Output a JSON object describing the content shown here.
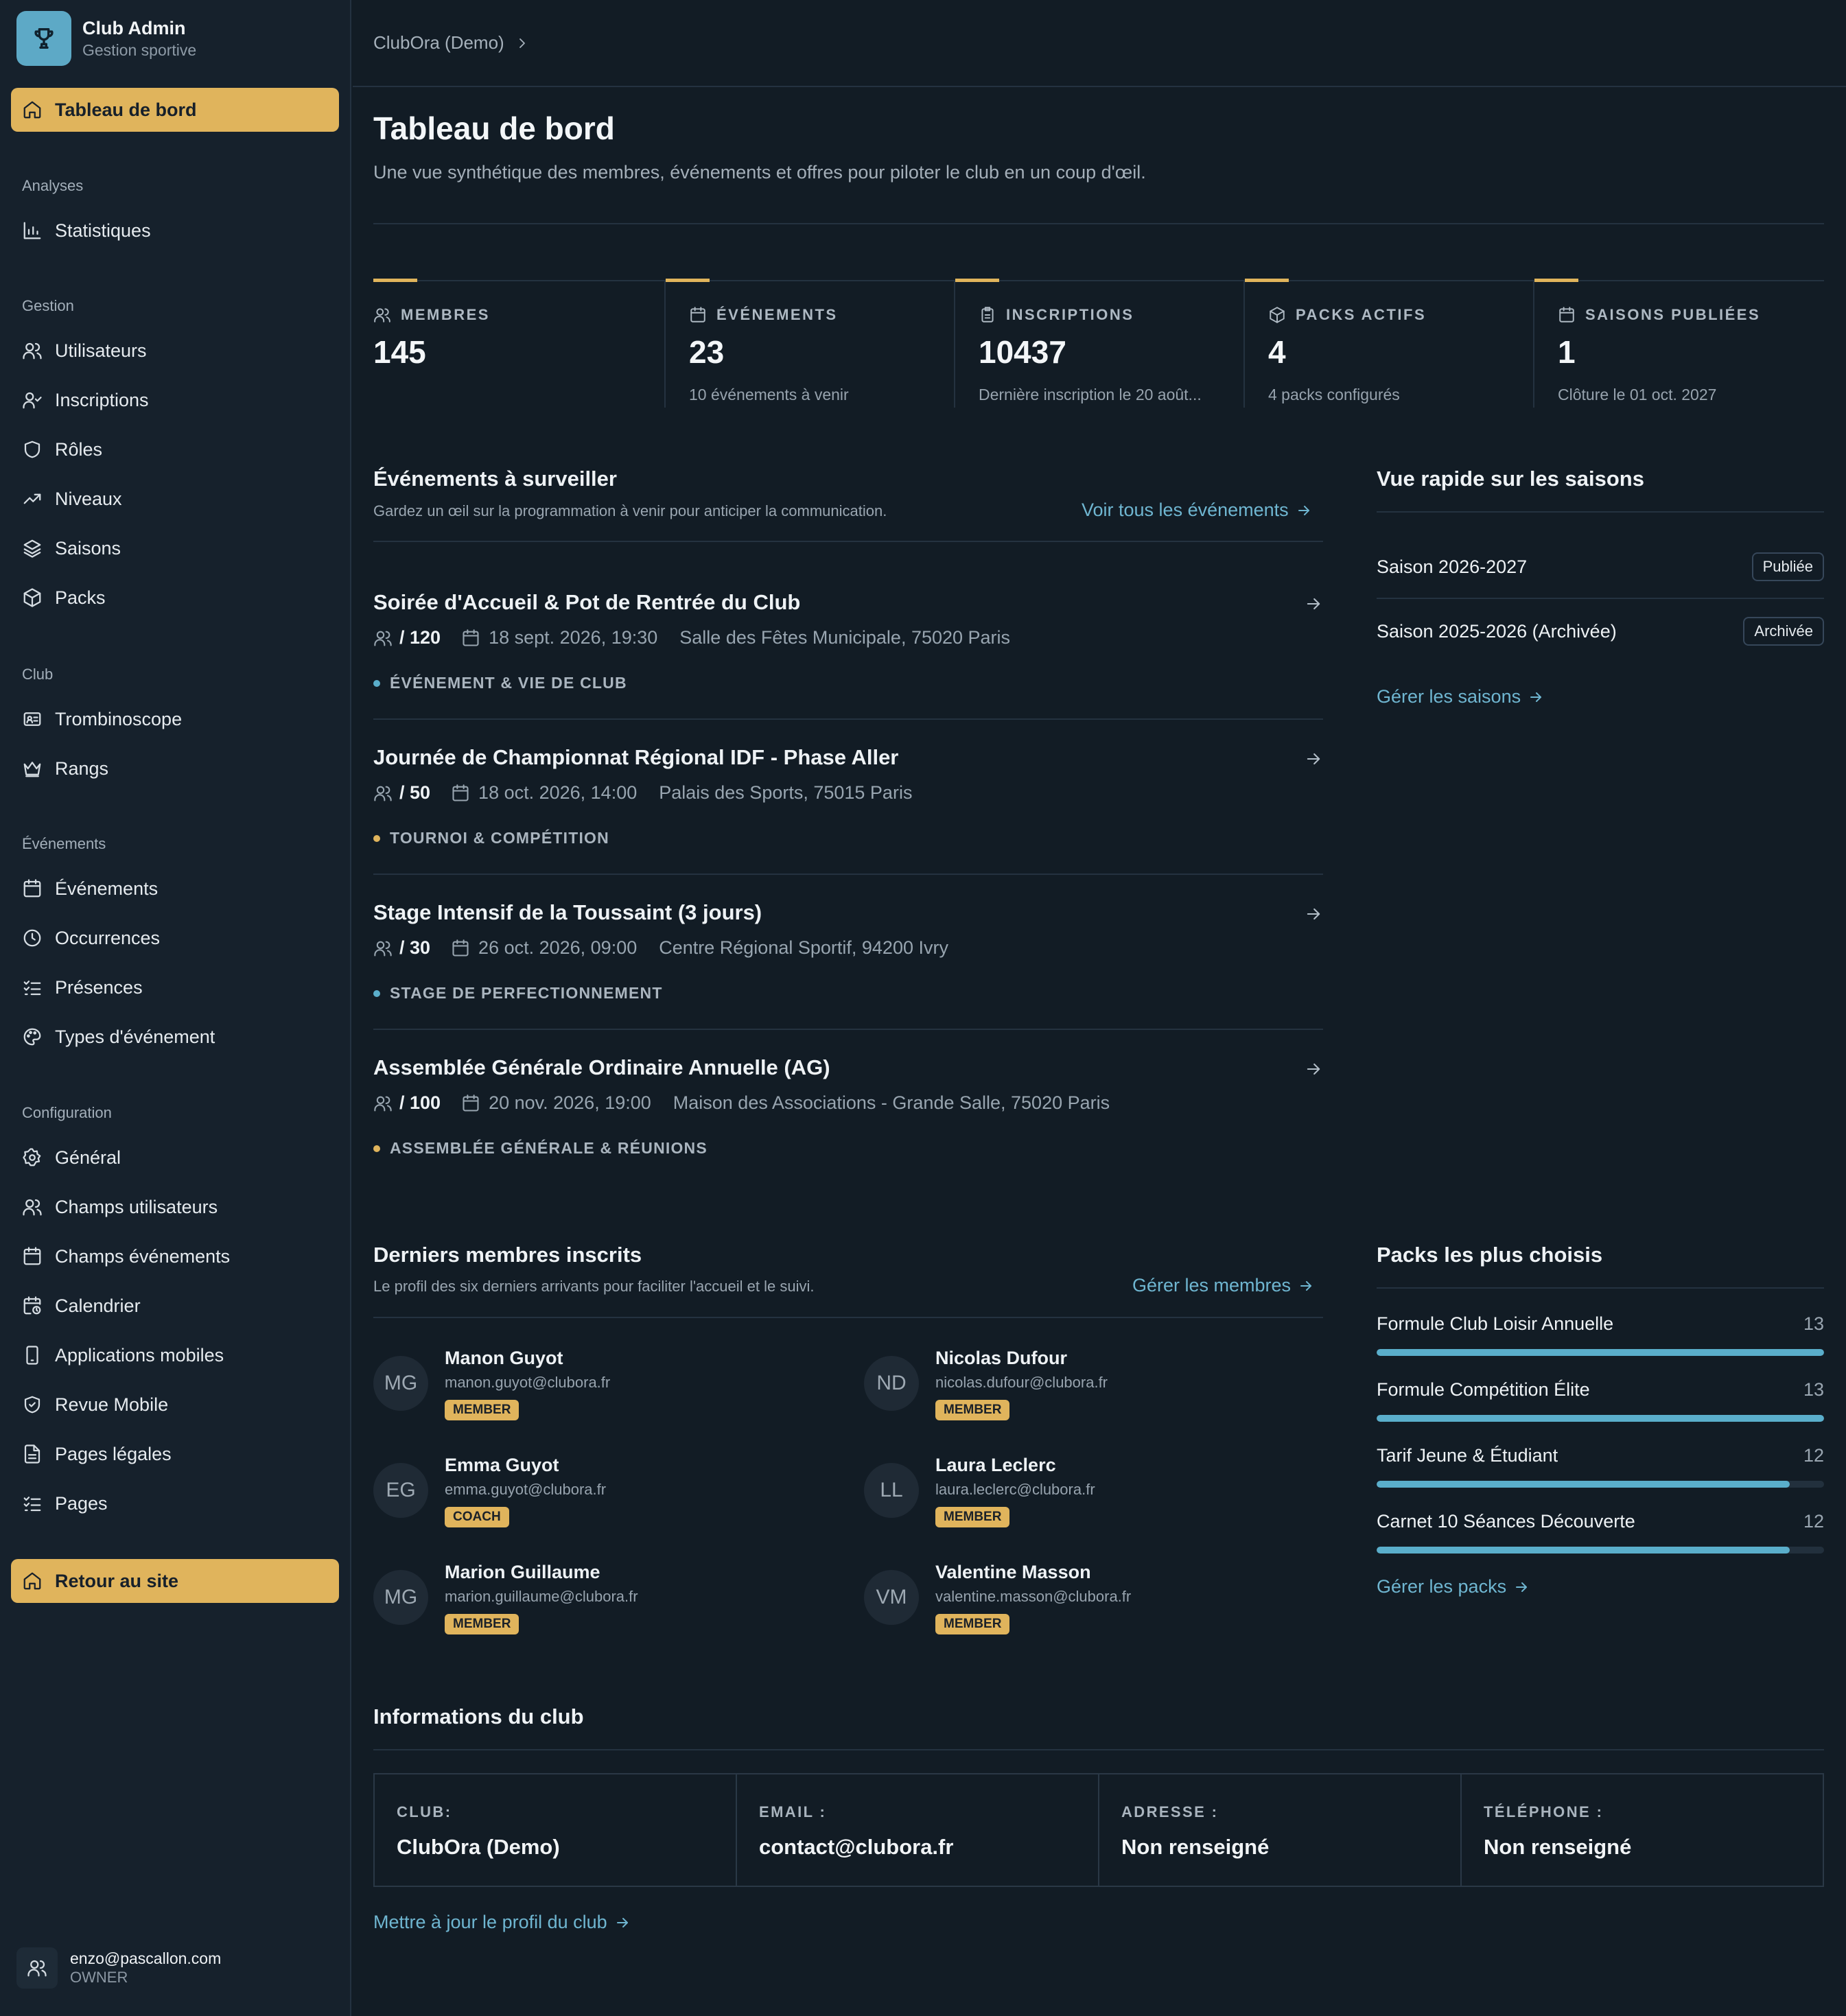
{
  "brand": {
    "name": "Club Admin",
    "subtitle": "Gestion sportive",
    "icon": "trophy-icon"
  },
  "sidebar": {
    "home": {
      "label": "Tableau de bord",
      "icon": "home-icon",
      "active": true
    },
    "groups": [
      {
        "title": "Analyses",
        "items": [
          {
            "label": "Statistiques",
            "icon": "bar-chart-icon"
          }
        ]
      },
      {
        "title": "Gestion",
        "items": [
          {
            "label": "Utilisateurs",
            "icon": "users-icon"
          },
          {
            "label": "Inscriptions",
            "icon": "user-check-icon"
          },
          {
            "label": "Rôles",
            "icon": "shield-icon"
          },
          {
            "label": "Niveaux",
            "icon": "trending-up-icon"
          },
          {
            "label": "Saisons",
            "icon": "layers-icon"
          },
          {
            "label": "Packs",
            "icon": "package-icon"
          }
        ]
      },
      {
        "title": "Club",
        "items": [
          {
            "label": "Trombinoscope",
            "icon": "id-card-icon"
          },
          {
            "label": "Rangs",
            "icon": "crown-icon"
          }
        ]
      },
      {
        "title": "Événements",
        "items": [
          {
            "label": "Événements",
            "icon": "calendar-icon"
          },
          {
            "label": "Occurrences",
            "icon": "clock-icon"
          },
          {
            "label": "Présences",
            "icon": "list-checks-icon"
          },
          {
            "label": "Types d'événement",
            "icon": "palette-icon"
          }
        ]
      },
      {
        "title": "Configuration",
        "items": [
          {
            "label": "Général",
            "icon": "gear-icon"
          },
          {
            "label": "Champs utilisateurs",
            "icon": "users-icon"
          },
          {
            "label": "Champs événements",
            "icon": "calendar-icon"
          },
          {
            "label": "Calendrier",
            "icon": "calendar-clock-icon"
          },
          {
            "label": "Applications mobiles",
            "icon": "smartphone-icon"
          },
          {
            "label": "Revue Mobile",
            "icon": "shield-check-icon"
          },
          {
            "label": "Pages légales",
            "icon": "file-text-icon"
          },
          {
            "label": "Pages",
            "icon": "list-checks-icon"
          }
        ]
      }
    ],
    "back": {
      "label": "Retour au site",
      "icon": "home-icon"
    },
    "user": {
      "email": "enzo@pascallon.com",
      "role": "OWNER",
      "icon": "users-icon"
    }
  },
  "breadcrumb": {
    "item": "ClubOra (Demo)",
    "icon": "chevron-right-icon"
  },
  "page": {
    "title": "Tableau de bord",
    "description": "Une vue synthétique des membres, événements et offres pour piloter le club en un coup d'œil."
  },
  "stats": [
    {
      "label": "MEMBRES",
      "value": "145",
      "sub": "",
      "icon": "users-icon"
    },
    {
      "label": "ÉVÉNEMENTS",
      "value": "23",
      "sub": "10 événements à venir",
      "icon": "calendar-icon"
    },
    {
      "label": "INSCRIPTIONS",
      "value": "10437",
      "sub": "Dernière inscription le 20 août...",
      "icon": "clipboard-icon"
    },
    {
      "label": "PACKS ACTIFS",
      "value": "4",
      "sub": "4 packs configurés",
      "icon": "package-icon"
    },
    {
      "label": "SAISONS PUBLIÉES",
      "value": "1",
      "sub": "Clôture le 01 oct. 2027",
      "icon": "calendar-icon"
    }
  ],
  "events_section": {
    "title": "Événements à surveiller",
    "description": "Gardez un œil sur la programmation à venir pour anticiper la communication.",
    "link": "Voir tous les événements",
    "events": [
      {
        "title": "Soirée d'Accueil & Pot de Rentrée du Club",
        "capacity": "/ 120",
        "date": "18 sept. 2026, 19:30",
        "place": "Salle des Fêtes Municipale, 75020 Paris",
        "tag": "ÉVÉNEMENT & VIE DE CLUB",
        "tag_color": "#5aaecb"
      },
      {
        "title": "Journée de Championnat Régional IDF - Phase Aller",
        "capacity": "/ 50",
        "date": "18 oct. 2026, 14:00",
        "place": "Palais des Sports, 75015 Paris",
        "tag": "TOURNOI & COMPÉTITION",
        "tag_color": "#e0b45c"
      },
      {
        "title": "Stage Intensif de la Toussaint (3 jours)",
        "capacity": "/ 30",
        "date": "26 oct. 2026, 09:00",
        "place": "Centre Régional Sportif, 94200 Ivry",
        "tag": "STAGE DE PERFECTIONNEMENT",
        "tag_color": "#5aaecb"
      },
      {
        "title": "Assemblée Générale Ordinaire Annuelle (AG)",
        "capacity": "/ 100",
        "date": "20 nov. 2026, 19:00",
        "place": "Maison des Associations - Grande Salle, 75020 Paris",
        "tag": "ASSEMBLÉE GÉNÉRALE & RÉUNIONS",
        "tag_color": "#e0b45c"
      }
    ]
  },
  "seasons_section": {
    "title": "Vue rapide sur les saisons",
    "seasons": [
      {
        "name": "Saison 2026-2027",
        "status": "Publiée"
      },
      {
        "name": "Saison 2025-2026 (Archivée)",
        "status": "Archivée"
      }
    ],
    "link": "Gérer les saisons"
  },
  "members_section": {
    "title": "Derniers membres inscrits",
    "description": "Le profil des six derniers arrivants pour faciliter l'accueil et le suivi.",
    "link": "Gérer les membres",
    "members": [
      {
        "initials": "MG",
        "name": "Manon Guyot",
        "email": "manon.guyot@clubora.fr",
        "role": "MEMBER"
      },
      {
        "initials": "ND",
        "name": "Nicolas Dufour",
        "email": "nicolas.dufour@clubora.fr",
        "role": "MEMBER"
      },
      {
        "initials": "EG",
        "name": "Emma Guyot",
        "email": "emma.guyot@clubora.fr",
        "role": "COACH"
      },
      {
        "initials": "LL",
        "name": "Laura Leclerc",
        "email": "laura.leclerc@clubora.fr",
        "role": "MEMBER"
      },
      {
        "initials": "MG",
        "name": "Marion Guillaume",
        "email": "marion.guillaume@clubora.fr",
        "role": "MEMBER"
      },
      {
        "initials": "VM",
        "name": "Valentine Masson",
        "email": "valentine.masson@clubora.fr",
        "role": "MEMBER"
      }
    ]
  },
  "packs_section": {
    "title": "Packs les plus choisis",
    "packs": [
      {
        "name": "Formule Club Loisir Annuelle",
        "count": 13,
        "fill": 1.0
      },
      {
        "name": "Formule Compétition Élite",
        "count": 13,
        "fill": 1.0
      },
      {
        "name": "Tarif Jeune & Étudiant",
        "count": 12,
        "fill": 0.923
      },
      {
        "name": "Carnet 10 Séances Découverte",
        "count": 12,
        "fill": 0.923
      }
    ],
    "link": "Gérer les packs"
  },
  "club_info": {
    "title": "Informations du club",
    "fields": [
      {
        "label": "CLUB:",
        "value": "ClubOra (Demo)"
      },
      {
        "label": "EMAIL :",
        "value": "contact@clubora.fr"
      },
      {
        "label": "ADRESSE :",
        "value": "Non renseigné"
      },
      {
        "label": "TÉLÉPHONE :",
        "value": "Non renseigné"
      }
    ],
    "link": "Mettre à jour le profil du club"
  },
  "colors": {
    "accent": "#e0b45c",
    "link": "#6fb6d1",
    "background": "#121c25",
    "sidebar": "#16212c"
  }
}
